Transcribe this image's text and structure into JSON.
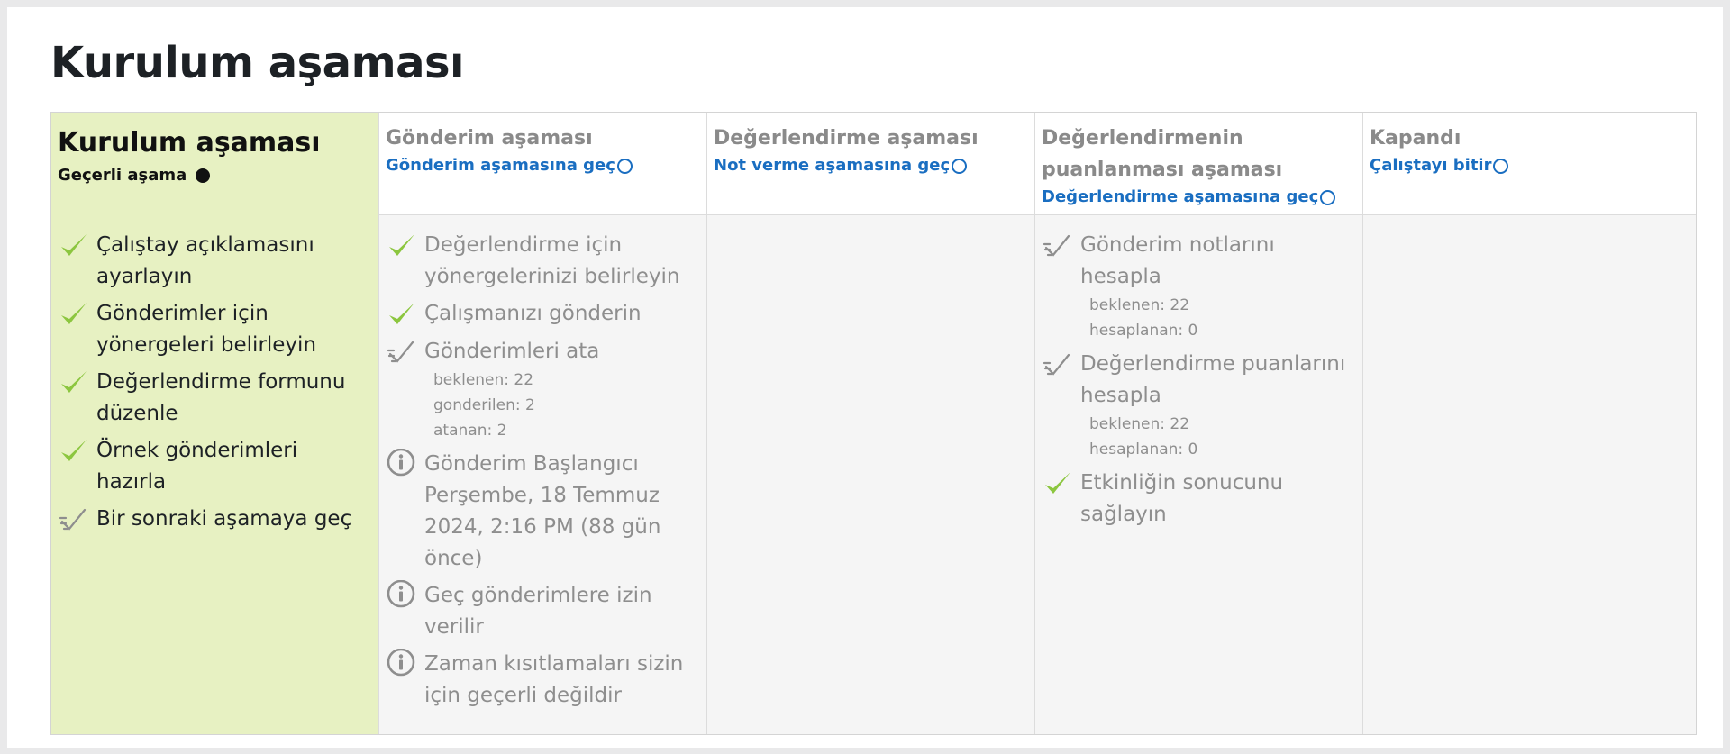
{
  "page_title": "Kurulum aşaması",
  "phases": [
    {
      "title": "Kurulum aşaması",
      "current_label": "Geçerli aşama",
      "tasks": [
        {
          "icon": "check-icon",
          "text": "Çalıştay açıklamasını ayarlayın"
        },
        {
          "icon": "check-icon",
          "text": "Gönderimler için yönergeleri belirleyin"
        },
        {
          "icon": "check-icon",
          "text": "Değerlendirme formunu düzenle"
        },
        {
          "icon": "check-icon",
          "text": "Örnek gönderimleri hazırla"
        },
        {
          "icon": "todo-icon",
          "text": "Bir sonraki aşamaya geç"
        }
      ]
    },
    {
      "title": "Gönderim aşaması",
      "link": "Gönderim aşamasına geç",
      "tasks": [
        {
          "icon": "check-icon",
          "text": "Değerlendirme için yönergelerinizi belirleyin"
        },
        {
          "icon": "check-icon",
          "text": "Çalışmanızı gönderin"
        },
        {
          "icon": "todo-icon",
          "text": "Gönderimleri ata",
          "details": [
            "beklenen: 22",
            "gonderilen: 2",
            "atanan: 2"
          ]
        },
        {
          "icon": "info-icon",
          "text": "Gönderim Başlangıcı Perşembe, 18 Temmuz 2024, 2:16 PM (88 gün önce)"
        },
        {
          "icon": "info-icon",
          "text": "Geç gönderimlere izin verilir"
        },
        {
          "icon": "info-icon",
          "text": "Zaman kısıtlamaları sizin için geçerli değildir"
        }
      ]
    },
    {
      "title": "Değerlendirme aşaması",
      "link": "Not verme aşamasına geç",
      "tasks": []
    },
    {
      "title": "Değerlendirmenin puanlanması aşaması",
      "link": "Değerlendirme aşamasına geç",
      "tasks": [
        {
          "icon": "todo-icon",
          "text": "Gönderim notlarını hesapla",
          "details": [
            "beklenen: 22",
            "hesaplanan: 0"
          ]
        },
        {
          "icon": "todo-icon",
          "text": "Değerlendirme puanlarını hesapla",
          "details": [
            "beklenen: 22",
            "hesaplanan: 0"
          ]
        },
        {
          "icon": "check-icon",
          "text": "Etkinliğin sonucunu sağlayın"
        }
      ]
    },
    {
      "title": "Kapandı",
      "link": "Çalıştayı bitir",
      "tasks": []
    }
  ],
  "colors": {
    "active_bg": "#e7f1c2",
    "check": "#8cc63f",
    "link": "#1a6ec1",
    "muted": "#8e8e8e"
  }
}
